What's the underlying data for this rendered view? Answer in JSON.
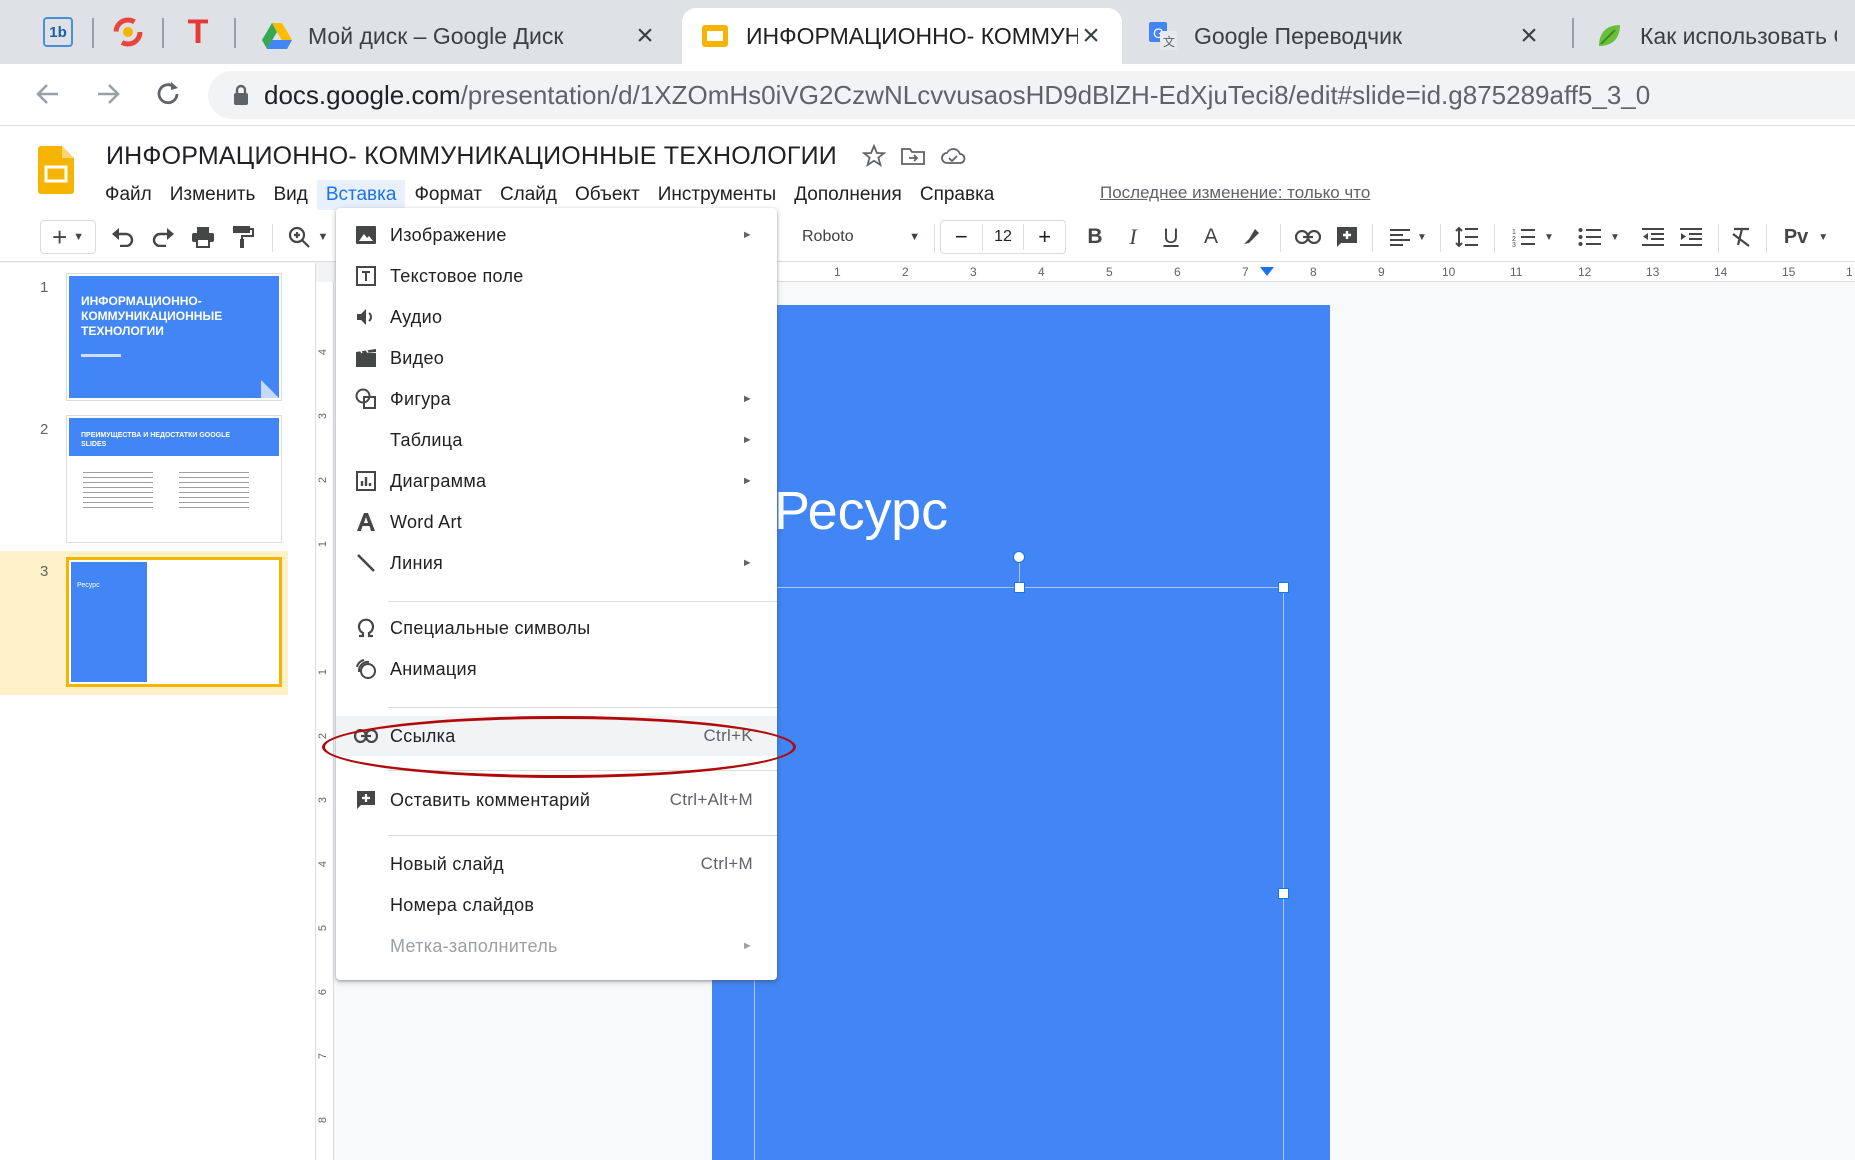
{
  "browser": {
    "pinned_tabs": [
      "1b",
      "",
      "T"
    ],
    "tabs": [
      {
        "title": "Мой диск – Google Диск",
        "icon": "google-drive-icon",
        "active": false
      },
      {
        "title": "ИНФОРМАЦИОННО- КОММУНИКАЦИОННЫЕ ТЕХНОЛОГИИ",
        "icon": "google-slides-icon",
        "active": true
      },
      {
        "title": "Google Переводчик",
        "icon": "google-translate-icon",
        "active": false
      },
      {
        "title": "Как использовать Google",
        "icon": "leaf-icon",
        "active": false
      }
    ],
    "url_host": "docs.google.com",
    "url_path": "/presentation/d/1XZOmHs0iVG2CzwNLcvvusaosHD9dBlZH-EdXjuTeci8/edit#slide=id.g875289aff5_3_0"
  },
  "app": {
    "title": "ИНФОРМАЦИОННО-  КОММУНИКАЦИОННЫЕ ТЕХНОЛОГИИ",
    "menu": [
      "Файл",
      "Изменить",
      "Вид",
      "Вставка",
      "Формат",
      "Слайд",
      "Объект",
      "Инструменты",
      "Дополнения",
      "Справка"
    ],
    "open_menu_index": 3,
    "last_edit": "Последнее изменение: только что"
  },
  "toolbar": {
    "font": "Roboto",
    "font_size": "12",
    "ruler_numbers": [
      "1",
      "2",
      "3",
      "4",
      "5",
      "6",
      "7",
      "8",
      "9",
      "10",
      "11",
      "12",
      "13",
      "14",
      "15",
      "1"
    ],
    "vruler_numbers": [
      "4",
      "3",
      "2",
      "1",
      "1",
      "2",
      "3",
      "4",
      "5",
      "6",
      "7",
      "8"
    ]
  },
  "filmstrip": [
    {
      "num": "1",
      "title": "ИНФОРМАЦИОННО- КОММУНИКАЦИОННЫЕ ТЕХНОЛОГИИ"
    },
    {
      "num": "2",
      "title": "ПРЕИМУЩЕСТВА И НЕДОСТАТКИ GOOGLE SLIDES"
    },
    {
      "num": "3",
      "title": "Ресурс"
    }
  ],
  "slide": {
    "title": "Ресурс"
  },
  "insert_menu": [
    {
      "label": "Изображение",
      "icon": "image-icon",
      "submenu": true
    },
    {
      "label": "Текстовое поле",
      "icon": "text-box-icon"
    },
    {
      "label": "Аудио",
      "icon": "audio-icon"
    },
    {
      "label": "Видео",
      "icon": "video-icon"
    },
    {
      "label": "Фигура",
      "icon": "shape-icon",
      "submenu": true
    },
    {
      "label": "Таблица",
      "icon": "",
      "submenu": true
    },
    {
      "label": "Диаграмма",
      "icon": "chart-icon",
      "submenu": true
    },
    {
      "label": "Word Art",
      "icon": "word-art-icon"
    },
    {
      "label": "Линия",
      "icon": "line-icon",
      "submenu": true
    },
    {
      "label": "Специальные символы",
      "icon": "omega-icon"
    },
    {
      "label": "Анимация",
      "icon": "animation-icon"
    },
    {
      "label": "Ссылка",
      "icon": "link-icon",
      "shortcut": "Ctrl+K"
    },
    {
      "label": "Оставить комментарий",
      "icon": "add-comment-icon",
      "shortcut": "Ctrl+Alt+M"
    },
    {
      "label": "Новый слайд",
      "icon": "",
      "shortcut": "Ctrl+M"
    },
    {
      "label": "Номера слайдов",
      "icon": ""
    },
    {
      "label": "Метка-заполнитель",
      "icon": "",
      "submenu": true,
      "disabled": true
    }
  ],
  "annotation_color": "#b00a0a",
  "accent": "#4285f4"
}
